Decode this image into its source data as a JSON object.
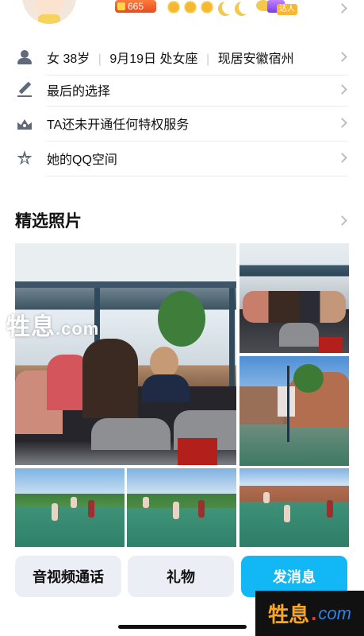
{
  "header": {
    "level_value": "665",
    "badge_label": "达人"
  },
  "info": {
    "profile": {
      "gender": "女",
      "age": "38岁",
      "birthday": "9月19日",
      "zodiac": "处女座",
      "location": "现居安徽宿州"
    },
    "signature": "最后的选择",
    "privilege": "TA还未开通任何特权服务",
    "qzone": "她的QQ空间"
  },
  "photos": {
    "title": "精选照片"
  },
  "actions": {
    "call": "音视频通话",
    "gift": "礼物",
    "message": "发消息"
  },
  "watermark": {
    "text": "牲息",
    "suffix": ".com",
    "corner_text": "牲息",
    "corner_dot": ".",
    "corner_suffix": "com"
  },
  "colors": {
    "primary": "#12b7f5",
    "gray_button": "#eceef5",
    "level_badge": "#e84b1e"
  },
  "icons": {
    "profile": "person-icon",
    "signature": "pen-icon",
    "privilege": "crown-icon",
    "qzone": "star-icon"
  }
}
